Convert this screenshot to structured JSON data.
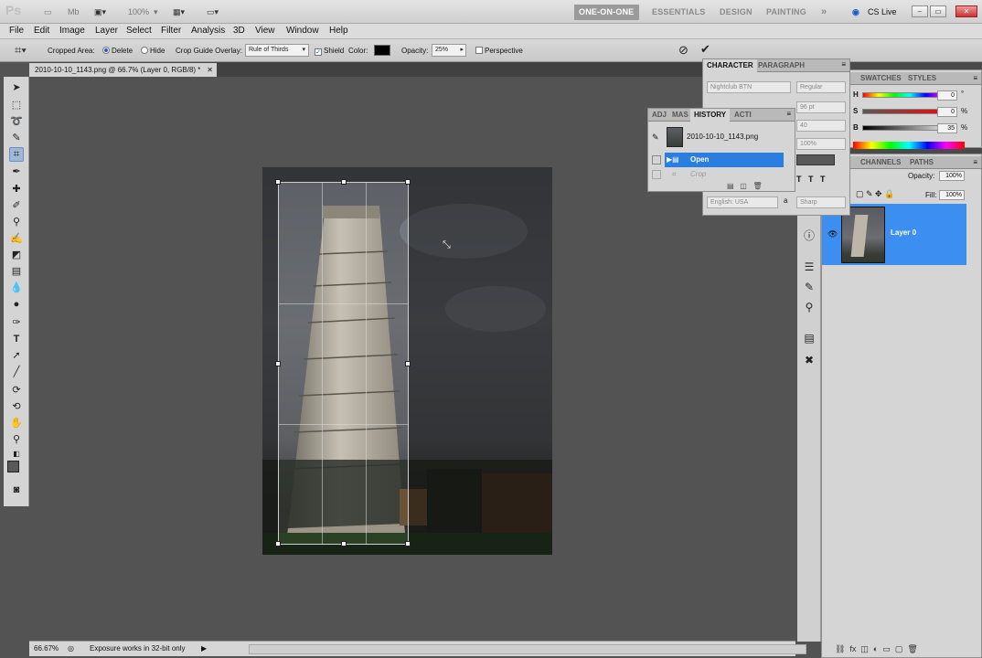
{
  "appbar": {
    "logo": "Ps",
    "zoom_value": "100%",
    "workspaces": [
      "ONE-ON-ONE",
      "ESSENTIALS",
      "DESIGN",
      "PAINTING"
    ],
    "more": "»",
    "cs_live": "CS Live"
  },
  "menu": [
    "File",
    "Edit",
    "Image",
    "Layer",
    "Select",
    "Filter",
    "Analysis",
    "3D",
    "View",
    "Window",
    "Help"
  ],
  "options": {
    "cropped_area_label": "Cropped Area:",
    "delete_label": "Delete",
    "hide_label": "Hide",
    "guide_label": "Crop Guide Overlay:",
    "guide_value": "Rule of Thirds",
    "shield_label": "Shield",
    "color_label": "Color:",
    "opacity_label": "Opacity:",
    "opacity_value": "25%",
    "perspective_label": "Perspective",
    "shield_checked": true,
    "perspective_checked": false,
    "delete_selected": true
  },
  "document": {
    "tab_title": "2010-10-10_1143.png @ 66.7% (Layer 0, RGB/8) *"
  },
  "status": {
    "zoom": "66.67%",
    "message": "Exposure works in 32-bit only"
  },
  "character": {
    "tabs": [
      "CHARACTER",
      "PARAGRAPH"
    ],
    "font": "Nightclub BTN",
    "style": "Regular",
    "size": "96 pt",
    "leading": "40",
    "scale": "100%",
    "language": "English: USA",
    "aa_label": "a",
    "antialias": "Sharp"
  },
  "history": {
    "tabs": [
      "ADJ",
      "MAS",
      "HISTORY",
      "ACTI"
    ],
    "snapshot": "2010-10-10_1143.png",
    "states": [
      "Open",
      "Crop"
    ]
  },
  "color": {
    "tabs": [
      "SWATCHES",
      "STYLES"
    ],
    "h_label": "H",
    "s_label": "S",
    "b_label": "B",
    "h_value": "0",
    "s_value": "0",
    "b_value": "35",
    "degree": "°",
    "pct": "%"
  },
  "layers": {
    "tabs": [
      "CHANNELS",
      "PATHS"
    ],
    "opacity_label": "Opacity:",
    "opacity_value": "100%",
    "fill_label": "Fill:",
    "fill_value": "100%",
    "layer_name": "Layer 0"
  },
  "colors": {
    "accent_blue": "#3c8ff0",
    "history_selected": "#2a7de1"
  }
}
